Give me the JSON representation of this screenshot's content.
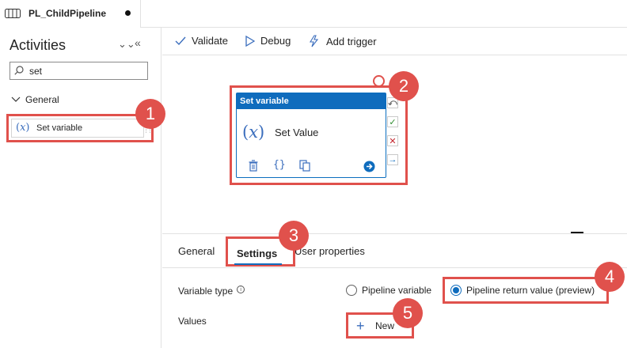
{
  "tab": {
    "title": "PL_ChildPipeline"
  },
  "sidebar": {
    "title": "Activities",
    "search_value": "set",
    "group_label": "General",
    "items": [
      {
        "label": "Set variable"
      }
    ]
  },
  "toolbar": {
    "validate_label": "Validate",
    "debug_label": "Debug",
    "add_trigger_label": "Add trigger"
  },
  "node": {
    "header": "Set variable",
    "name": "Set Value",
    "icon_glyph": "(𝑥)"
  },
  "panel": {
    "tabs": [
      "General",
      "Settings",
      "User properties"
    ],
    "variable_type_label": "Variable type",
    "radio_pipeline_variable": "Pipeline variable",
    "radio_return_value": "Pipeline return value (preview)",
    "values_label": "Values",
    "new_label": "New"
  },
  "callouts": [
    "1",
    "2",
    "3",
    "4",
    "5"
  ],
  "colors": {
    "accent": "#0f6cbd",
    "callout": "#e0514c"
  }
}
